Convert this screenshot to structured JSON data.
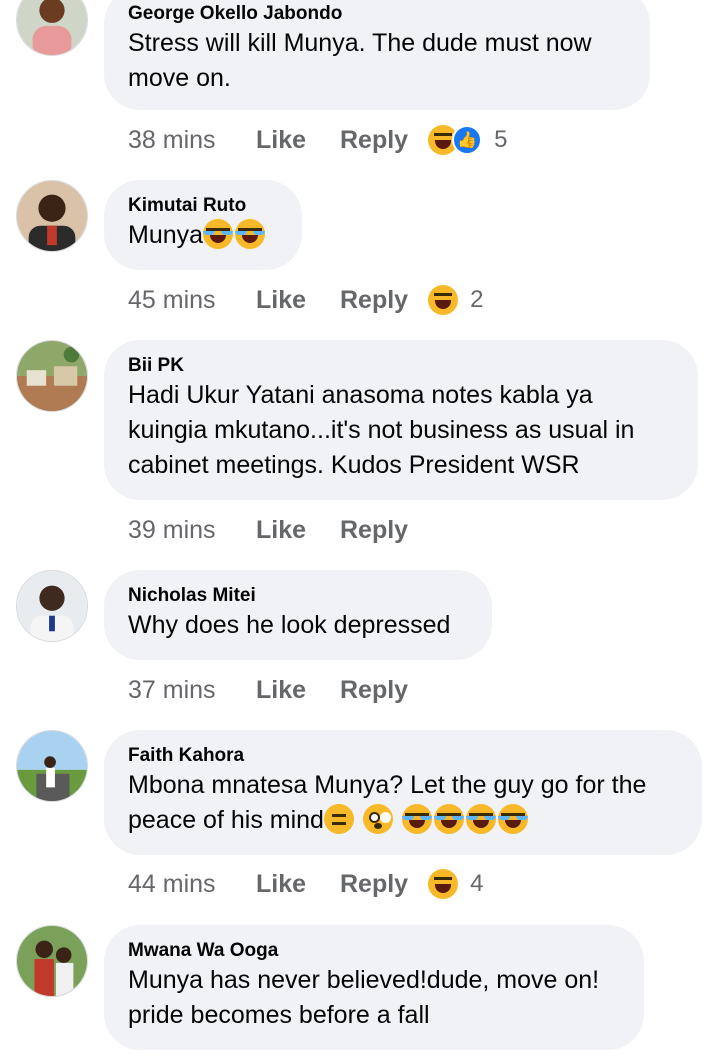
{
  "comments": [
    {
      "author": "George Okello Jabondo",
      "lines": [
        "Stress will kill Munya. The dude must now",
        "move on."
      ],
      "time": "38 mins",
      "like": "Like",
      "reply": "Reply",
      "reactions": [
        "haha",
        "like"
      ],
      "count": "5"
    },
    {
      "author": "Kimutai Ruto",
      "lines": [
        "Munya"
      ],
      "emojis": [
        "tears-of-joy",
        "tears-of-joy"
      ],
      "time": "45 mins",
      "like": "Like",
      "reply": "Reply",
      "reactions": [
        "haha"
      ],
      "count": "2"
    },
    {
      "author": "Bii PK",
      "lines": [
        "Hadi Ukur Yatani anasoma notes kabla ya",
        "kuingia mkutano...it's not business as usual in",
        "cabinet meetings. Kudos President WSR"
      ],
      "time": "39 mins",
      "like": "Like",
      "reply": "Reply"
    },
    {
      "author": "Nicholas Mitei",
      "lines": [
        "Why does he look depressed"
      ],
      "time": "37 mins",
      "like": "Like",
      "reply": "Reply"
    },
    {
      "author": "Faith Kahora",
      "lines": [
        "Mbona mnatesa Munya? Let the guy go for the",
        "peace of his mind"
      ],
      "emojis": [
        "thinking",
        "flushed",
        "tears-of-joy",
        "tears-of-joy",
        "tears-of-joy",
        "tears-of-joy"
      ],
      "time": "44 mins",
      "like": "Like",
      "reply": "Reply",
      "reactions": [
        "haha"
      ],
      "count": "4"
    },
    {
      "author": "Mwana Wa Ooga",
      "lines": [
        "Munya has never believed!dude, move on!",
        "pride becomes before a fall"
      ]
    }
  ],
  "colors": {
    "bubble": "#f0f2f5",
    "meta": "#65676b",
    "haha": "#f7b928",
    "like": "#1877f2"
  }
}
